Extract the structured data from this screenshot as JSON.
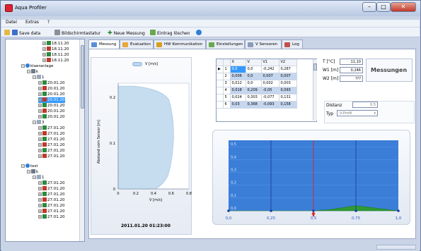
{
  "window": {
    "title": "Aqua Profiler"
  },
  "menu": {
    "items": [
      "Datei",
      "Extras",
      "?"
    ]
  },
  "toolbar": {
    "save_label": "Save data",
    "keyboard_label": "Bildschirmtastatur",
    "new_measurement_label": "Neue Messung",
    "delete_entry_label": "Eintrag löschen"
  },
  "tree": {
    "top_dates": [
      "18.11.20",
      "18.11.20",
      "18.11.20",
      "18.11.20"
    ],
    "group1": {
      "name": "klaeranlage",
      "sub": "k",
      "folder": "1",
      "dates": [
        "20.01.20",
        "20.01.20",
        "20.01.20",
        "20.01.20",
        "20.01.20",
        "20.01.20",
        "20.01.20"
      ],
      "selected_index": 3
    },
    "group1b": {
      "folder": "3",
      "dates": [
        "27.01.20",
        "27.01.20",
        "27.01.20",
        "27.01.20",
        "27.01.20",
        "27.01.20"
      ]
    },
    "group2": {
      "name": "test",
      "sub": "k",
      "folder": "1",
      "dates": [
        "27.01.20",
        "27.01.20",
        "27.01.20",
        "27.01.20",
        "27.01.20",
        "27.01.20",
        "27.01.20"
      ]
    }
  },
  "tabs": [
    {
      "label": "Messung",
      "active": true,
      "color": "#5a8fd8"
    },
    {
      "label": "Evaluation",
      "color": "#e8a83a"
    },
    {
      "label": "HW Kommunikation",
      "color": "#d8a020"
    },
    {
      "label": "Einstellungen",
      "color": "#6aa84f"
    },
    {
      "label": "V Sensoren",
      "color": "#8a9bbb"
    },
    {
      "label": "Log",
      "color": "#c0504d"
    }
  ],
  "profile_chart": {
    "legend": "V [m/s]",
    "ylabel": "Abstand vom Sensor [m]",
    "xlabel": "V [m/s]",
    "xticks": [
      "0",
      "0.2",
      "0.4",
      "0.6",
      "0.8"
    ],
    "yticks": [
      "0",
      "0.1",
      "0.2"
    ],
    "timestamp": "2011.01.20 01:23:00",
    "fill_color": "#c6dcef"
  },
  "grid": {
    "columns": [
      "X",
      "V",
      "V1",
      "V2"
    ],
    "rows": [
      {
        "n": "1",
        "cells": [
          "0,0",
          "0,0",
          "-0,242",
          "0,287"
        ]
      },
      {
        "n": "2",
        "cells": [
          "0,006",
          "0,0",
          "0,007",
          "0,007"
        ]
      },
      {
        "n": "3",
        "cells": [
          "0,012",
          "0,0",
          "0,002",
          "0,003"
        ]
      },
      {
        "n": "4",
        "cells": [
          "0,018",
          "0,209",
          "-0,05",
          "0,093"
        ]
      },
      {
        "n": "5",
        "cells": [
          "0,024",
          "0,303",
          "-0,077",
          "0,131"
        ]
      },
      {
        "n": "6",
        "cells": [
          "0,03",
          "0,368",
          "-0,093",
          "0,158"
        ]
      }
    ]
  },
  "readouts": {
    "t_label": "T [°C]",
    "t_value": "11,10",
    "w1_label": "W1 [m]",
    "w1_value": "0,246",
    "w2_label": "W2 [m]",
    "w2_value": "???",
    "status": "Messungen",
    "distance_label": "Distanz",
    "distance_value": "0,5",
    "type_label": "Typ",
    "type_value": "V-Profil"
  },
  "chart_data": {
    "type": "area",
    "x": [
      0,
      0.25,
      0.5,
      0.6,
      0.75,
      1.0
    ],
    "values": [
      0,
      0,
      0,
      0.01,
      0.04,
      0
    ],
    "xticks": [
      "0,0",
      "0,25",
      "0,5",
      "0,75",
      "1,0"
    ],
    "yticks": [
      "0,0",
      "0,1",
      "0,2",
      "0,3",
      "0,4",
      "0,5"
    ],
    "ylim": [
      0,
      0.55
    ],
    "xlim": [
      0,
      1.0
    ],
    "vertical_lines": [
      0.25,
      0.5,
      0.75
    ],
    "marker_x": 0.5,
    "background": "#3b7ed8",
    "fill": "#2f9a34",
    "marker_color": "#d4242a"
  }
}
